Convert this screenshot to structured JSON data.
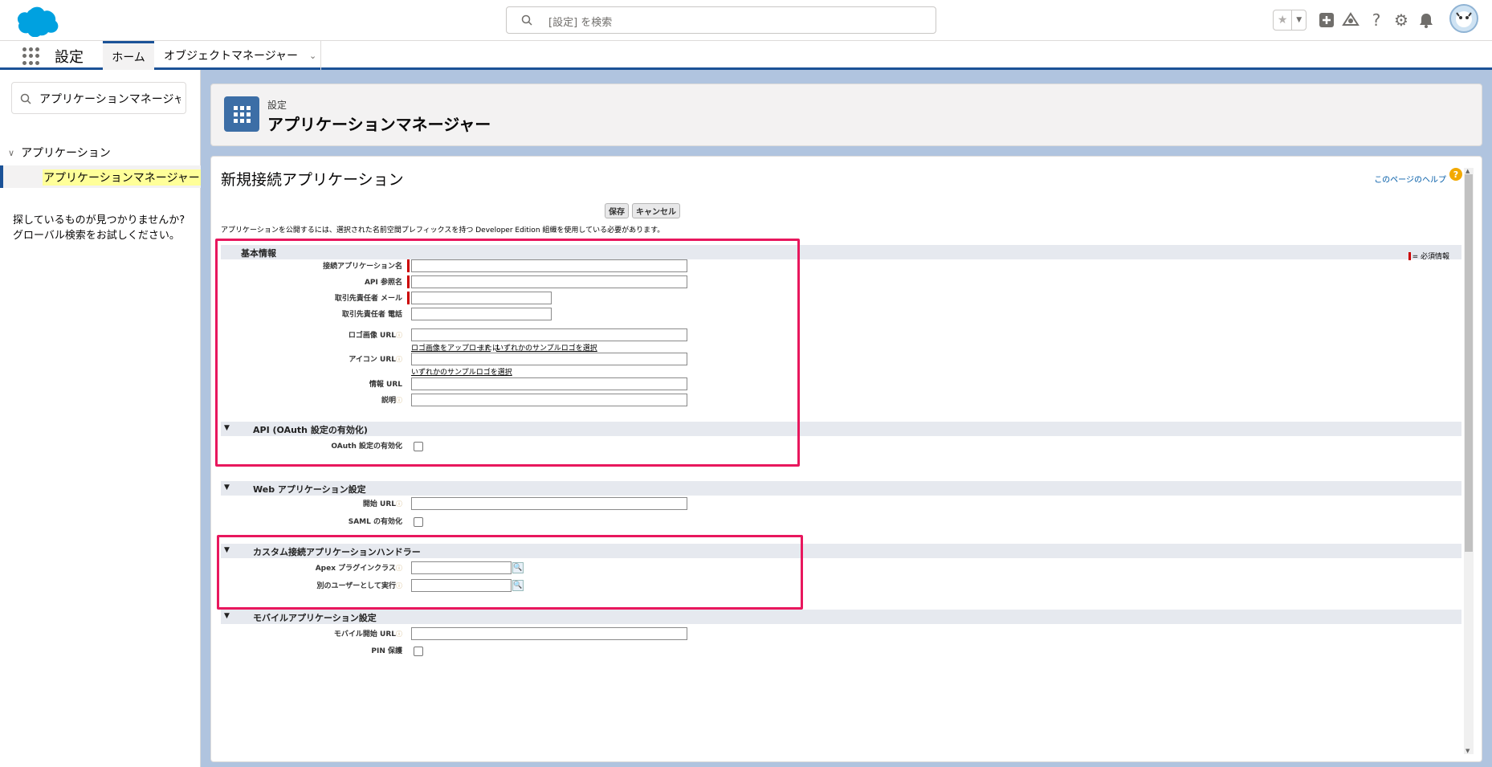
{
  "topbar": {
    "search_placeholder": "[設定] を検索"
  },
  "nav": {
    "app_name": "設定",
    "tabs": [
      "ホーム",
      "オブジェクトマネージャー"
    ]
  },
  "sidebar": {
    "quickfind_value": "アプリケーションマネージャー",
    "tree_parent": "アプリケーション",
    "tree_child": "アプリケーションマネージャー",
    "not_found_line1": "探しているものが見つかりませんか?",
    "not_found_line2": "グローバル検索をお試しください。"
  },
  "header": {
    "breadcrumb": "設定",
    "title": "アプリケーションマネージャー"
  },
  "form": {
    "page_title": "新規接続アプリケーション",
    "help_link": "このページのヘルプ",
    "save_label": "保存",
    "cancel_label": "キャンセル",
    "publish_note": "アプリケーションを公開するには、選択された名前空間プレフィックスを持つ Developer Edition 組織を使用している必要があります。",
    "required_legend": "= 必須情報",
    "sections": {
      "basic": "基本情報",
      "api": "API (OAuth 設定の有効化)",
      "web": "Web アプリケーション設定",
      "handler": "カスタム接続アプリケーションハンドラー",
      "mobile": "モバイルアプリケーション設定"
    },
    "fields": {
      "app_name": "接続アプリケーション名",
      "api_name": "API 参照名",
      "contact_email": "取引先責任者 メール",
      "contact_phone": "取引先責任者 電話",
      "logo_url": "ロゴ画像 URL",
      "icon_url": "アイコン URL",
      "info_url": "情報 URL",
      "description": "説明",
      "oauth_enable": "OAuth 設定の有効化",
      "start_url": "開始 URL",
      "saml_enable": "SAML の有効化",
      "apex_plugin": "Apex プラグインクラス",
      "run_as": "別のユーザーとして実行",
      "mobile_start_url": "モバイル開始 URL",
      "pin_protect": "PIN 保護"
    },
    "links": {
      "upload_logo": "ロゴ画像をアップロード",
      "or": "または",
      "choose_sample_logo": "いずれかのサンプルロゴを選択",
      "choose_sample_logo2": "いずれかのサンプルロゴを選択"
    }
  },
  "colors": {
    "brand_blue": "#1b5297",
    "highlight_border": "#e8175d",
    "required_red": "#cc0000",
    "page_bg": "#b0c4df"
  }
}
